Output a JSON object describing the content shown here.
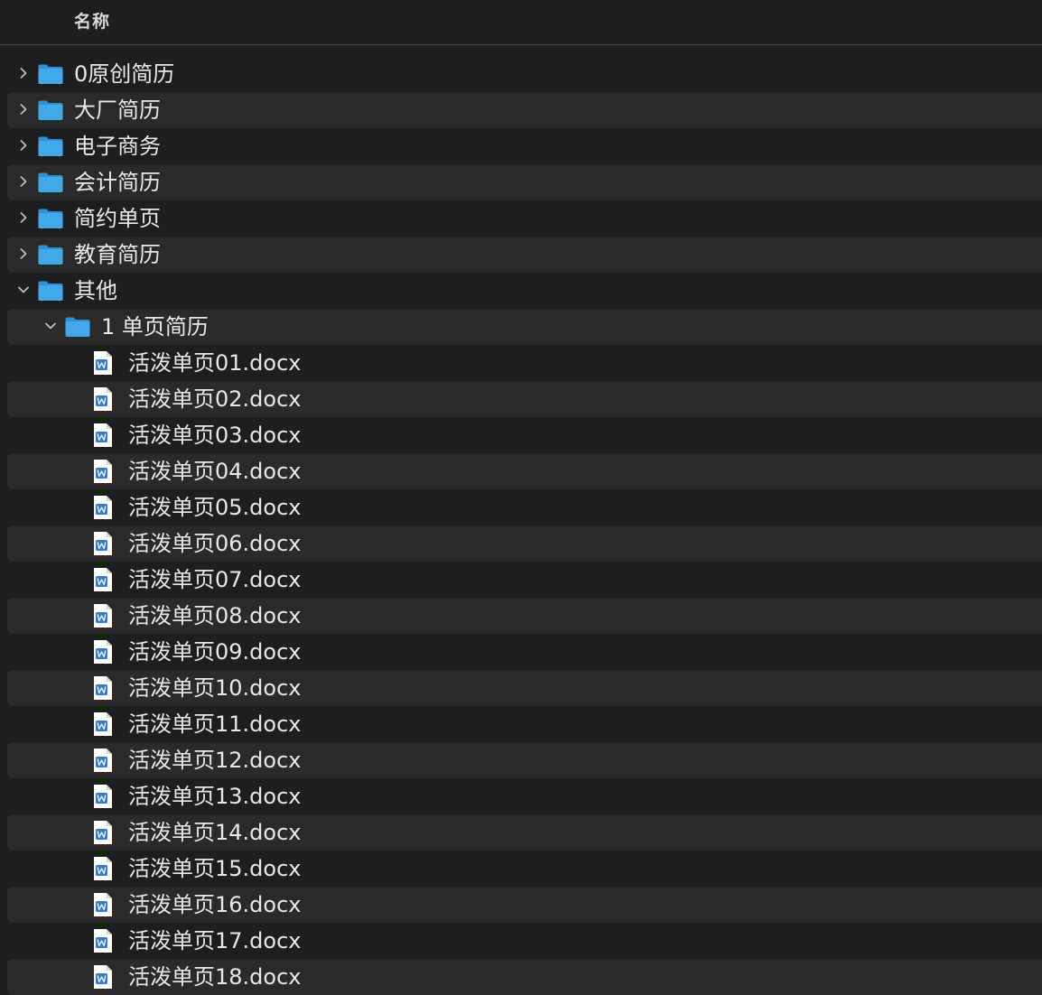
{
  "header": {
    "name_column": "名称"
  },
  "colors": {
    "background": "#1e1e1e",
    "stripe": "#2a2a2a",
    "folder_blue": "#41a8ea",
    "doc_blue": "#2f7ae0",
    "text": "#e8e8e8"
  },
  "items": [
    {
      "name": "0原创简历",
      "kind": "folder",
      "level": 0,
      "expanded": false,
      "icon": "folder-icon"
    },
    {
      "name": "大厂简历",
      "kind": "folder",
      "level": 0,
      "expanded": false,
      "icon": "folder-icon"
    },
    {
      "name": "电子商务",
      "kind": "folder",
      "level": 0,
      "expanded": false,
      "icon": "folder-icon"
    },
    {
      "name": "会计简历",
      "kind": "folder",
      "level": 0,
      "expanded": false,
      "icon": "folder-icon"
    },
    {
      "name": "简约单页",
      "kind": "folder",
      "level": 0,
      "expanded": false,
      "icon": "folder-icon"
    },
    {
      "name": "教育简历",
      "kind": "folder",
      "level": 0,
      "expanded": false,
      "icon": "folder-icon"
    },
    {
      "name": "其他",
      "kind": "folder",
      "level": 0,
      "expanded": true,
      "icon": "folder-icon"
    },
    {
      "name": "1 单页简历",
      "kind": "folder",
      "level": 1,
      "expanded": true,
      "icon": "folder-icon"
    },
    {
      "name": "活泼单页01.docx",
      "kind": "file",
      "level": 2,
      "icon": "word-document-icon"
    },
    {
      "name": "活泼单页02.docx",
      "kind": "file",
      "level": 2,
      "icon": "word-document-icon"
    },
    {
      "name": "活泼单页03.docx",
      "kind": "file",
      "level": 2,
      "icon": "word-document-icon"
    },
    {
      "name": "活泼单页04.docx",
      "kind": "file",
      "level": 2,
      "icon": "word-document-icon"
    },
    {
      "name": "活泼单页05.docx",
      "kind": "file",
      "level": 2,
      "icon": "word-document-icon"
    },
    {
      "name": "活泼单页06.docx",
      "kind": "file",
      "level": 2,
      "icon": "word-document-icon"
    },
    {
      "name": "活泼单页07.docx",
      "kind": "file",
      "level": 2,
      "icon": "word-document-icon"
    },
    {
      "name": "活泼单页08.docx",
      "kind": "file",
      "level": 2,
      "icon": "word-document-icon"
    },
    {
      "name": "活泼单页09.docx",
      "kind": "file",
      "level": 2,
      "icon": "word-document-icon"
    },
    {
      "name": "活泼单页10.docx",
      "kind": "file",
      "level": 2,
      "icon": "word-document-icon"
    },
    {
      "name": "活泼单页11.docx",
      "kind": "file",
      "level": 2,
      "icon": "word-document-icon"
    },
    {
      "name": "活泼单页12.docx",
      "kind": "file",
      "level": 2,
      "icon": "word-document-icon"
    },
    {
      "name": "活泼单页13.docx",
      "kind": "file",
      "level": 2,
      "icon": "word-document-icon"
    },
    {
      "name": "活泼单页14.docx",
      "kind": "file",
      "level": 2,
      "icon": "word-document-icon"
    },
    {
      "name": "活泼单页15.docx",
      "kind": "file",
      "level": 2,
      "icon": "word-document-icon"
    },
    {
      "name": "活泼单页16.docx",
      "kind": "file",
      "level": 2,
      "icon": "word-document-icon"
    },
    {
      "name": "活泼单页17.docx",
      "kind": "file",
      "level": 2,
      "icon": "word-document-icon"
    },
    {
      "name": "活泼单页18.docx",
      "kind": "file",
      "level": 2,
      "icon": "word-document-icon"
    }
  ]
}
